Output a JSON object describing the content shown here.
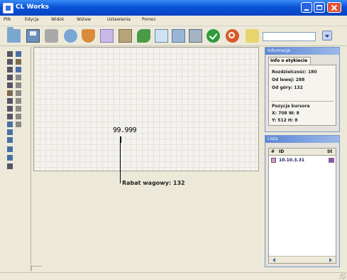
{
  "window": {
    "title": "CL Works"
  },
  "menu": [
    "Plik",
    "Edycja",
    "Widok",
    "Wstaw",
    "Ustawienia",
    "Pomoc"
  ],
  "toolbar": {
    "icons": [
      "open-folder-icon",
      "save-icon",
      "print-icon",
      "print-preview-icon",
      "cut-icon",
      "copy-icon",
      "paste-icon",
      "format-brush-icon",
      "table-icon",
      "image-icon",
      "layout-icon",
      "ok-icon",
      "cancel-icon",
      "zoom-icon"
    ],
    "zoom_value": ""
  },
  "canvas": {
    "value_text": "99.999",
    "callout": "Rabat wagowy: 132"
  },
  "properties_panel": {
    "title": "Informacje",
    "tab": "Info o etykiecie",
    "lines": [
      "Rozdzielczość: 180",
      "Od lewej: 288",
      "Od góry: 132",
      "Pozycja kursora",
      "X: 708    W: 8",
      "Y: 512    H: 8"
    ]
  },
  "list_panel": {
    "title": "Lista",
    "columns": [
      "#",
      "ID",
      "St"
    ],
    "rows": [
      {
        "text": "10.10.3.31"
      }
    ]
  },
  "status": {
    "text": ""
  }
}
